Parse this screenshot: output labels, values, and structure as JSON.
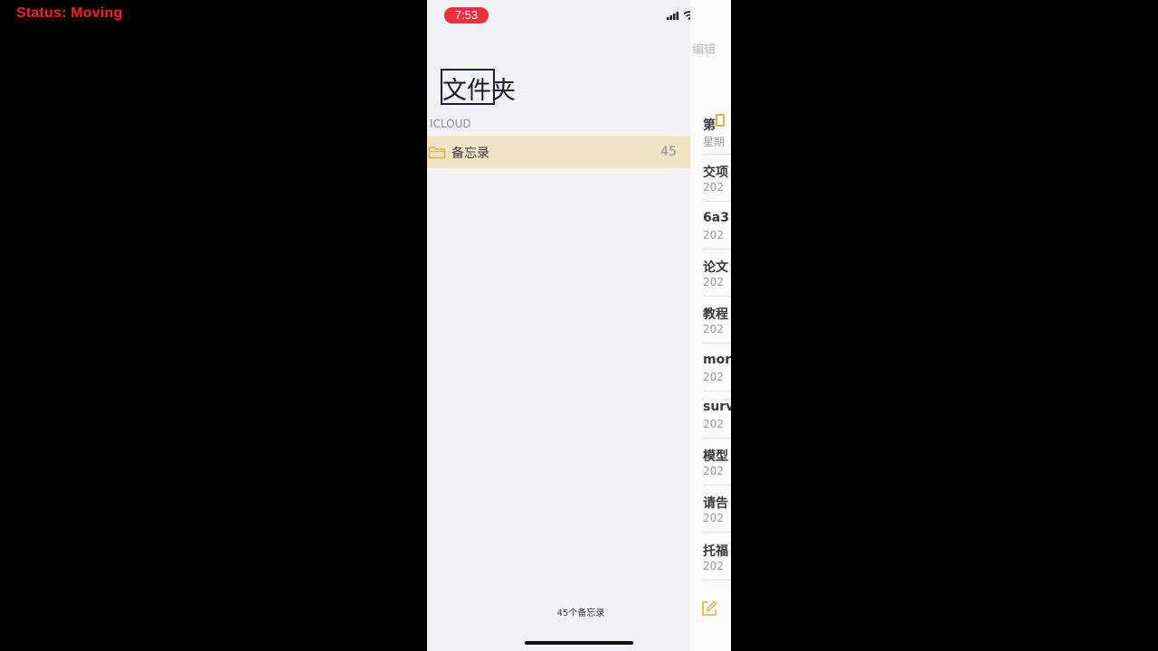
{
  "overlay": {
    "status": "Status:  Moving"
  },
  "status_bar": {
    "time": "7:53"
  },
  "folders_pane": {
    "title": "文件夹",
    "section": "ICLOUD",
    "folders": [
      {
        "label": "备忘录",
        "count": "45",
        "icon": "folder-icon"
      }
    ],
    "footer": "45个备忘录"
  },
  "notes_pane": {
    "edit_label": "编辑",
    "notes": [
      {
        "title": "第",
        "subtitle": "星期"
      },
      {
        "title": "交项",
        "subtitle": "202"
      },
      {
        "title": "6a3",
        "subtitle": "202"
      },
      {
        "title": "论文",
        "subtitle": "202"
      },
      {
        "title": "教程",
        "subtitle": "202"
      },
      {
        "title": "mor",
        "subtitle": "202"
      },
      {
        "title": "surv",
        "subtitle": "202"
      },
      {
        "title": "模型",
        "subtitle": "202"
      },
      {
        "title": "请告",
        "subtitle": "202"
      },
      {
        "title": "托福",
        "subtitle": "202"
      }
    ],
    "compose_icon": "compose-icon"
  },
  "colors": {
    "accent": "#e0b343",
    "time_pill": "#e8303f",
    "selected_row": "#efe4c4",
    "highlight_box": "#1d1a4d",
    "overlay_text": "#ff1e1e"
  }
}
